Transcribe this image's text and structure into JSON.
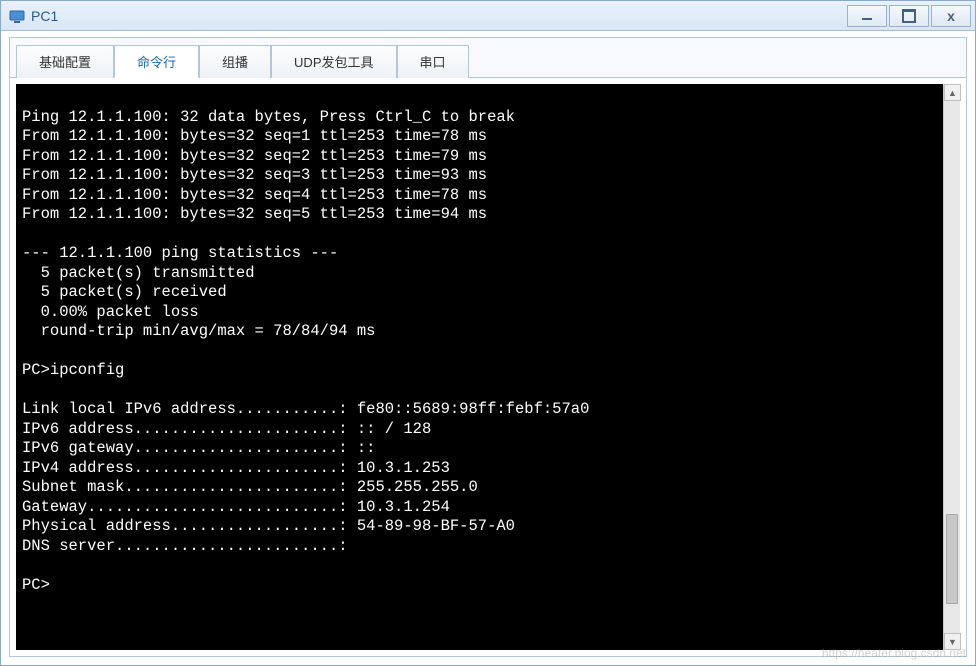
{
  "window": {
    "title": "PC1"
  },
  "tabs": [
    {
      "label": "基础配置",
      "active": false
    },
    {
      "label": "命令行",
      "active": true
    },
    {
      "label": "组播",
      "active": false
    },
    {
      "label": "UDP发包工具",
      "active": false
    },
    {
      "label": "串口",
      "active": false
    }
  ],
  "terminal_lines": [
    "",
    "Ping 12.1.1.100: 32 data bytes, Press Ctrl_C to break",
    "From 12.1.1.100: bytes=32 seq=1 ttl=253 time=78 ms",
    "From 12.1.1.100: bytes=32 seq=2 ttl=253 time=79 ms",
    "From 12.1.1.100: bytes=32 seq=3 ttl=253 time=93 ms",
    "From 12.1.1.100: bytes=32 seq=4 ttl=253 time=78 ms",
    "From 12.1.1.100: bytes=32 seq=5 ttl=253 time=94 ms",
    "",
    "--- 12.1.1.100 ping statistics ---",
    "  5 packet(s) transmitted",
    "  5 packet(s) received",
    "  0.00% packet loss",
    "  round-trip min/avg/max = 78/84/94 ms",
    "",
    "PC>ipconfig",
    "",
    "Link local IPv6 address...........: fe80::5689:98ff:febf:57a0",
    "IPv6 address......................: :: / 128",
    "IPv6 gateway......................: ::",
    "IPv4 address......................: 10.3.1.253",
    "Subnet mask.......................: 255.255.255.0",
    "Gateway...........................: 10.3.1.254",
    "Physical address..................: 54-89-98-BF-57-A0",
    "DNS server........................:",
    "",
    "PC>"
  ],
  "watermark": "https://heater.blog.csdn.net"
}
